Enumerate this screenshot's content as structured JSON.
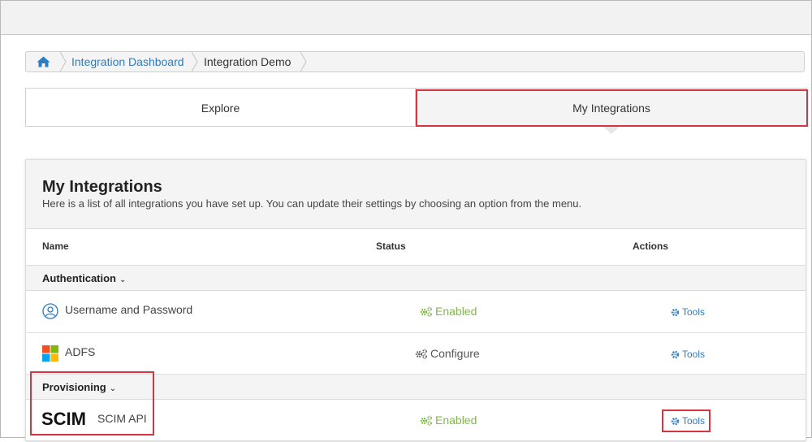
{
  "breadcrumb": {
    "home_icon": "home-icon",
    "items": [
      {
        "label": "Integration Dashboard"
      },
      {
        "label": "Integration Demo"
      }
    ]
  },
  "tabs": [
    {
      "label": "Explore",
      "selected": false
    },
    {
      "label": "My Integrations",
      "selected": true
    }
  ],
  "panel": {
    "title": "My Integrations",
    "description": "Here is a list of all integrations you have set up. You can update their settings by choosing an option from the menu.",
    "columns": [
      "Name",
      "Status",
      "Actions"
    ]
  },
  "groups": [
    {
      "label": "Authentication",
      "rows": [
        {
          "name": "Username and Password",
          "icon": "user-circle-icon",
          "status": "Enabled",
          "action": "Tools"
        },
        {
          "name": "ADFS",
          "icon": "windows-logo-icon",
          "status": "Configure",
          "action": "Tools"
        }
      ]
    },
    {
      "label": "Provisioning",
      "rows": [
        {
          "name": "SCIM API",
          "icon": "scim-logo",
          "logo_text": "SCIM",
          "status": "Enabled",
          "action": "Tools"
        }
      ]
    }
  ],
  "colors": {
    "link": "#2f7cc1",
    "enabled": "#7dbb42",
    "highlight": "#d7343f"
  }
}
